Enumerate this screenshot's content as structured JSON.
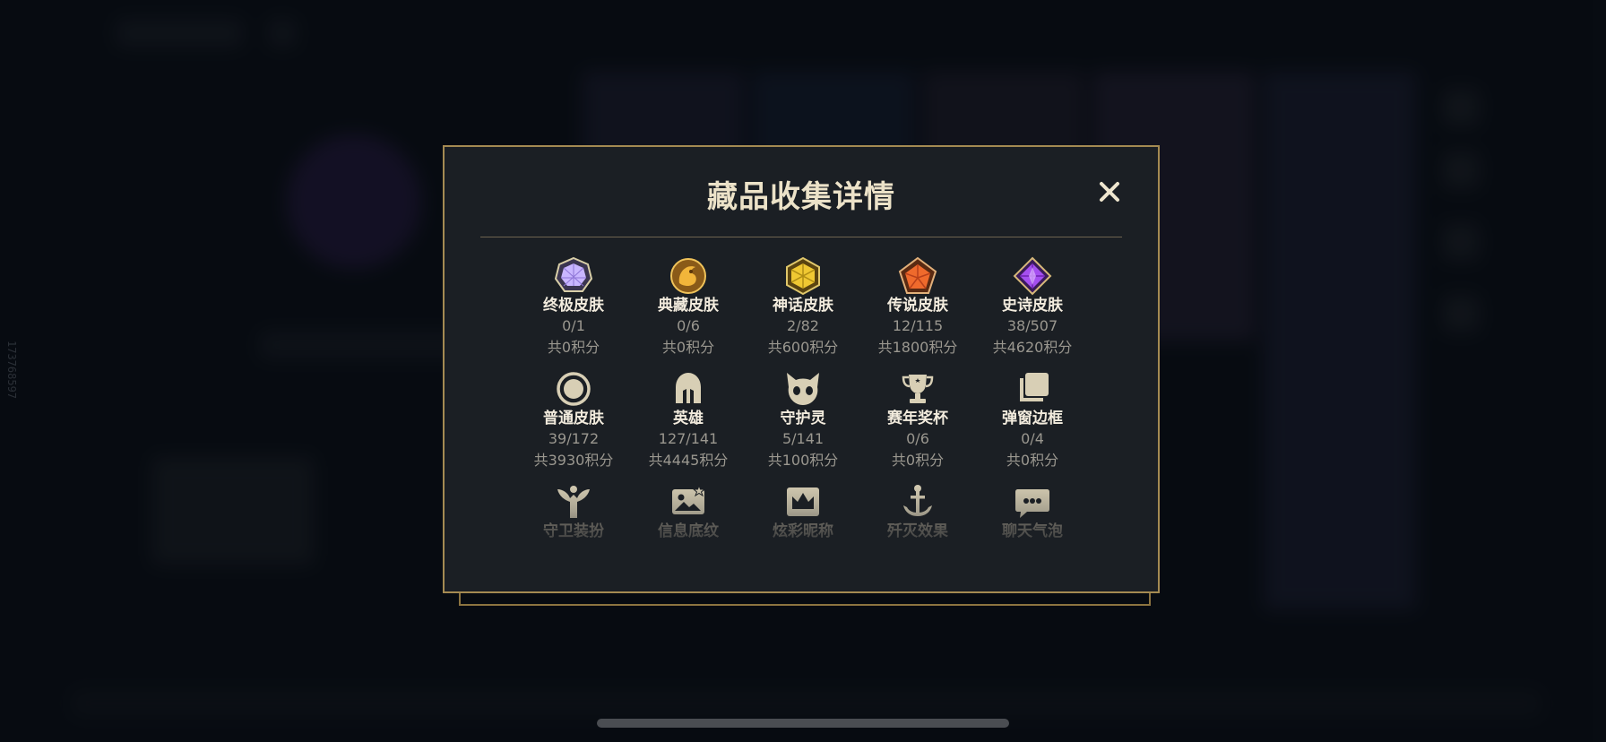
{
  "background_id": "173768597",
  "modal": {
    "title": "藏品收集详情",
    "close_label": "✕"
  },
  "rows": [
    [
      {
        "name": "终极皮肤",
        "count": "0/1",
        "points": "共0积分",
        "icon": "ultimate-gem-icon",
        "color": "#b9a2f0"
      },
      {
        "name": "典藏皮肤",
        "count": "0/6",
        "points": "共0积分",
        "icon": "dragon-emblem-icon",
        "color": "#d9a33a"
      },
      {
        "name": "神话皮肤",
        "count": "2/82",
        "points": "共600积分",
        "icon": "mythic-hexagon-icon",
        "color": "#e6c03a"
      },
      {
        "name": "传说皮肤",
        "count": "12/115",
        "points": "共1800积分",
        "icon": "legendary-pentagon-icon",
        "color": "#e0692f"
      },
      {
        "name": "史诗皮肤",
        "count": "38/507",
        "points": "共4620积分",
        "icon": "epic-diamond-icon",
        "color": "#9f4fe0"
      }
    ],
    [
      {
        "name": "普通皮肤",
        "count": "39/172",
        "points": "共3930积分",
        "icon": "circle-icon",
        "color": "#d8cfb5"
      },
      {
        "name": "英雄",
        "count": "127/141",
        "points": "共4445积分",
        "icon": "helmet-icon",
        "color": "#d8cfb5"
      },
      {
        "name": "守护灵",
        "count": "5/141",
        "points": "共100积分",
        "icon": "guardian-pet-icon",
        "color": "#d8cfb5"
      },
      {
        "name": "赛年奖杯",
        "count": "0/6",
        "points": "共0积分",
        "icon": "trophy-icon",
        "color": "#d8cfb5"
      },
      {
        "name": "弹窗边框",
        "count": "0/4",
        "points": "共0积分",
        "icon": "frame-stack-icon",
        "color": "#d8cfb5"
      }
    ],
    [
      {
        "name": "守卫装扮",
        "icon": "ward-skin-icon",
        "color": "#d8cfb5"
      },
      {
        "name": "信息底纹",
        "icon": "banner-image-icon",
        "color": "#d8cfb5"
      },
      {
        "name": "炫彩昵称",
        "icon": "crown-badge-icon",
        "color": "#d8cfb5"
      },
      {
        "name": "歼灭效果",
        "icon": "anchor-icon",
        "color": "#d8cfb5"
      },
      {
        "name": "聊天气泡",
        "icon": "chat-bubble-icon",
        "color": "#d8cfb5"
      }
    ]
  ]
}
